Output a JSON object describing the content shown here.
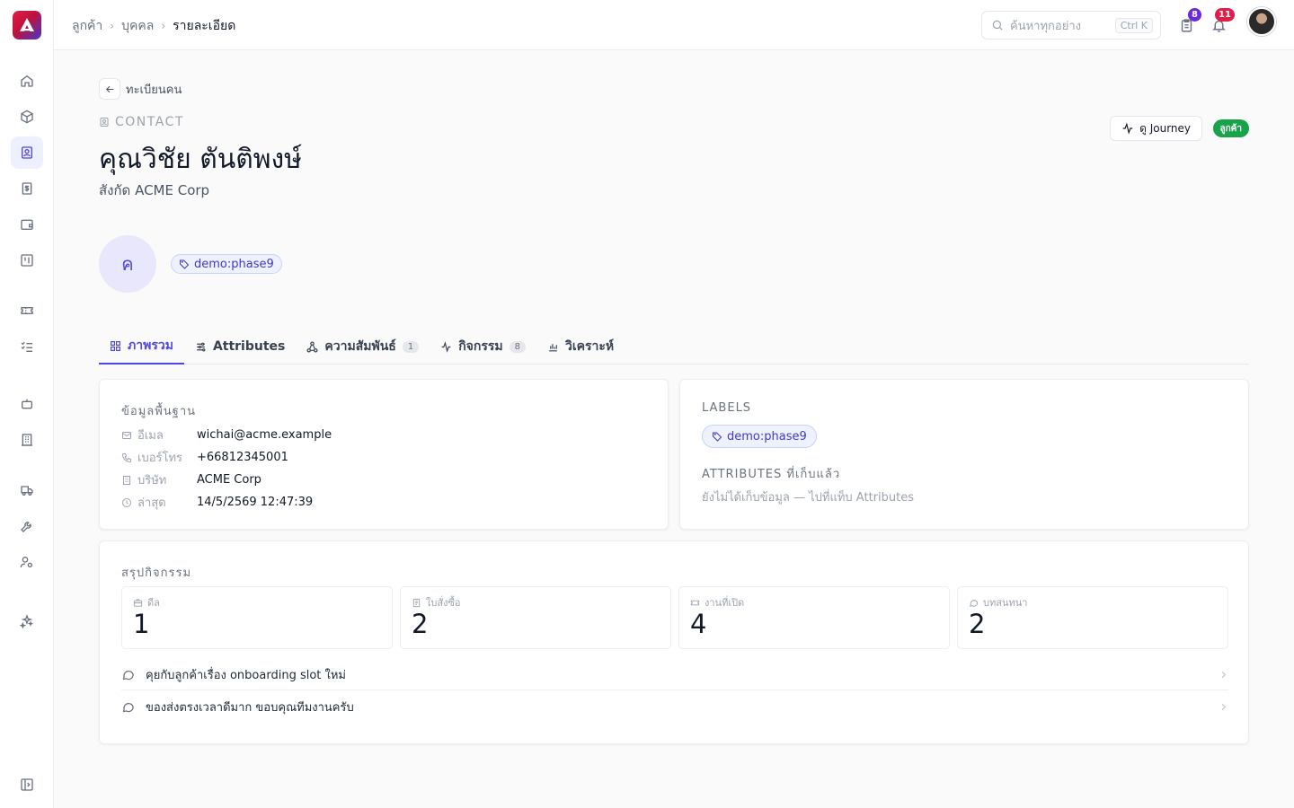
{
  "breadcrumb": {
    "level1": "ลูกค้า",
    "level2": "บุคคล",
    "current": "รายละเอียด"
  },
  "search": {
    "placeholder": "ค้นหาทุกอย่าง",
    "shortcut": "Ctrl K"
  },
  "notifications": {
    "tasks_count": "8",
    "alerts_count": "11"
  },
  "back_label": "ทะเบียนคน",
  "contact": {
    "kicker": "CONTACT",
    "name": "คุณวิชัย ตันติพงษ์",
    "affiliation": "สังกัด ACME Corp",
    "initial": "ค",
    "tag": "demo:phase9",
    "status": "ลูกค้า",
    "journey_label": "ดู Journey"
  },
  "tabs": [
    {
      "label": "ภาพรวม"
    },
    {
      "label": "Attributes"
    },
    {
      "label": "ความสัมพันธ์",
      "count": "1"
    },
    {
      "label": "กิจกรรม",
      "count": "8"
    },
    {
      "label": "วิเคราะห์"
    }
  ],
  "basic_info": {
    "title": "ข้อมูลพื้นฐาน",
    "email_label": "อีเมล",
    "email": "wichai@acme.example",
    "phone_label": "เบอร์โทร",
    "phone": "+66812345001",
    "company_label": "บริษัท",
    "company": "ACME Corp",
    "latest_label": "ล่าสุด",
    "latest": "14/5/2569 12:47:39"
  },
  "labels_card": {
    "title": "LABELS",
    "tag": "demo:phase9",
    "attributes_title": "ATTRIBUTES ที่เก็บแล้ว",
    "attributes_empty": "ยังไม่ได้เก็บข้อมูล — ไปที่แท็บ Attributes"
  },
  "summary": {
    "title": "สรุปกิจกรรม",
    "stats": [
      {
        "label": "ดีล",
        "value": "1"
      },
      {
        "label": "ใบสั่งซื้อ",
        "value": "2"
      },
      {
        "label": "งานที่เปิด",
        "value": "4"
      },
      {
        "label": "บทสนทนา",
        "value": "2"
      }
    ],
    "activities": [
      {
        "text": "คุยกับลูกค้าเรื่อง onboarding slot ใหม่"
      },
      {
        "text": "ของส่งตรงเวลาดีมาก ขอบคุณทีมงานครับ"
      }
    ]
  },
  "colors": {
    "accent": "#4f46e5",
    "status_green": "#16a34a",
    "badge_purple": "#6d28d9",
    "badge_red": "#e11d48"
  }
}
